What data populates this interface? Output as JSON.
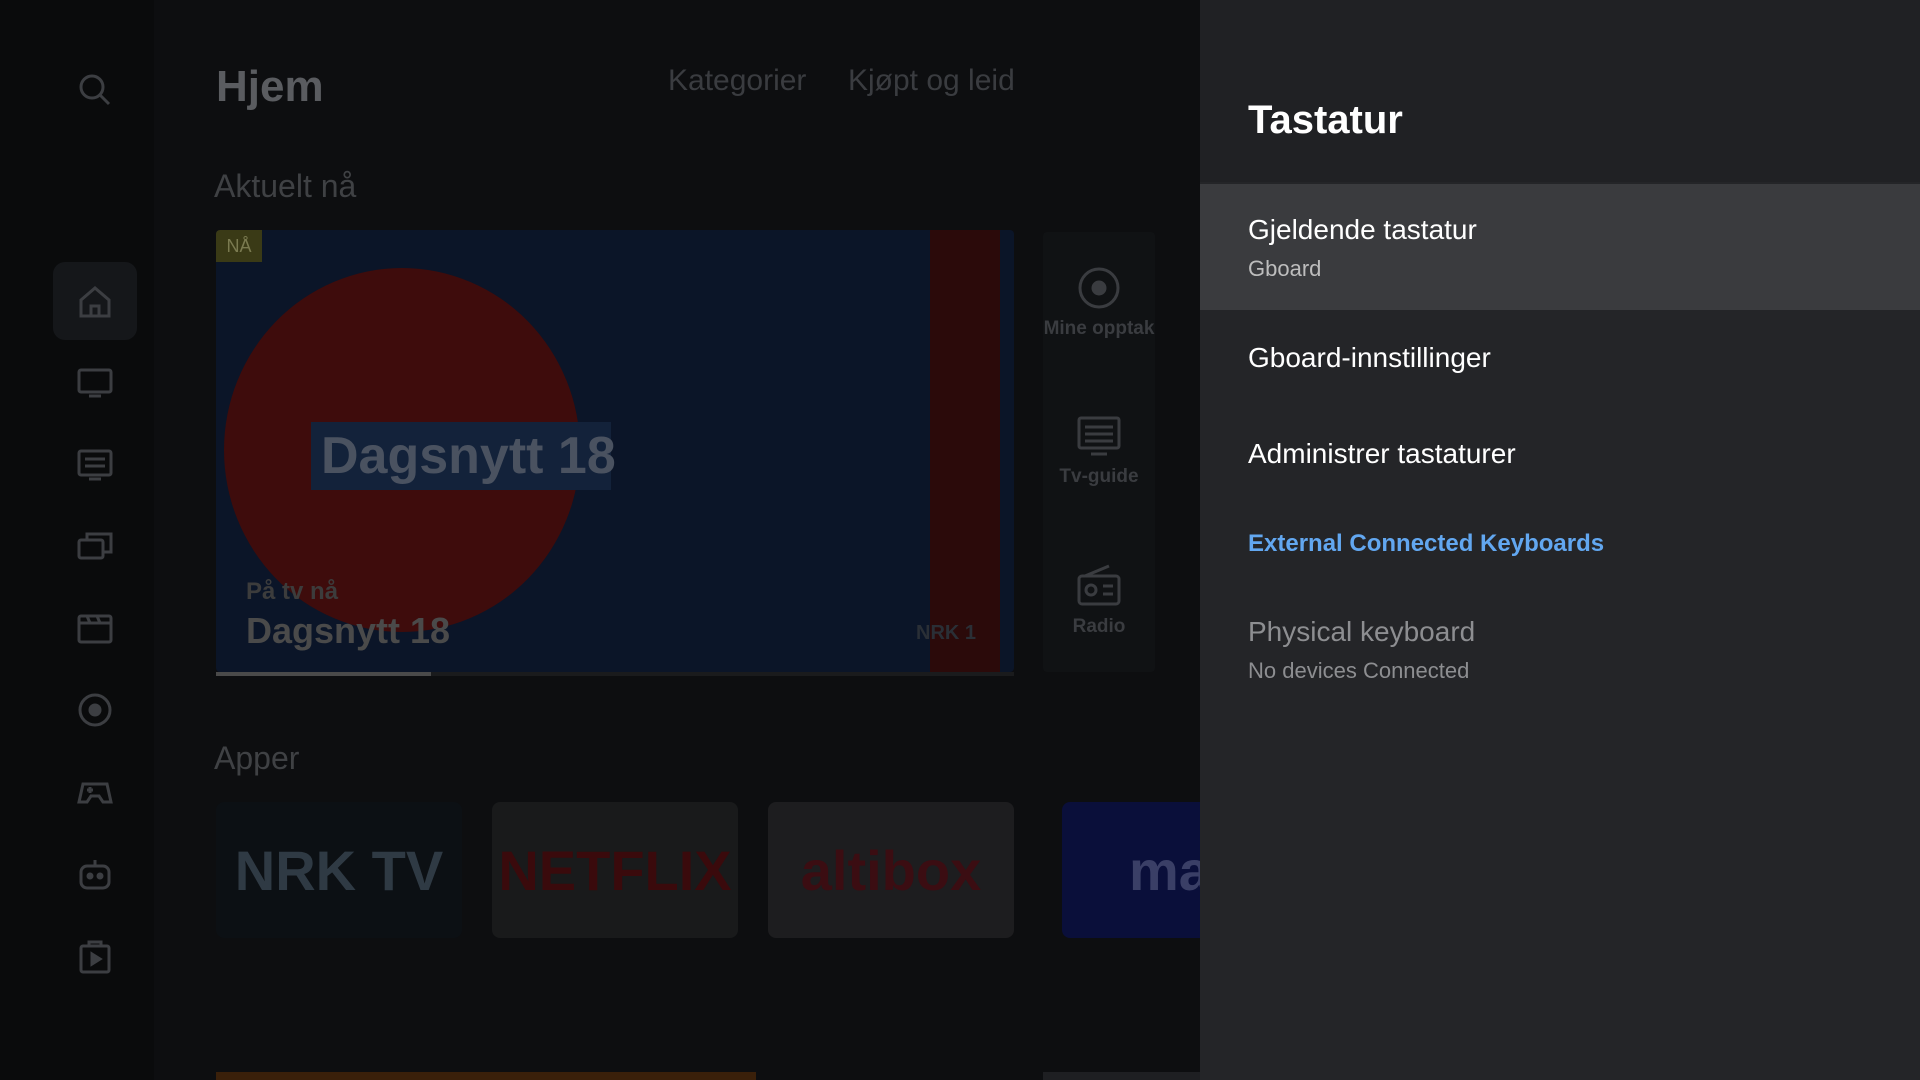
{
  "background": {
    "page_title": "Hjem",
    "nav_tabs": [
      "Kategorier",
      "Kjøpt og leid"
    ],
    "featured": {
      "section_title": "Aktuelt nå",
      "badge": "NÅ",
      "big_title": "Dagsnytt 18",
      "subtitle": "På tv nå",
      "title": "Dagsnytt 18",
      "channel_logo": "NRK 1",
      "progress": 0.27
    },
    "shortcuts": [
      {
        "icon": "record-icon",
        "label": "Mine opptak"
      },
      {
        "icon": "tv-guide-icon",
        "label": "Tv-guide"
      },
      {
        "icon": "radio-icon",
        "label": "Radio"
      }
    ],
    "apps_section_title": "Apper",
    "apps": [
      {
        "name": "NRK TV",
        "bg": "#0c1014",
        "color": "#2f3a44"
      },
      {
        "name": "NETFLIX",
        "bg": "#191a1b",
        "color": "#3a0a0c"
      },
      {
        "name": "altibox",
        "bg": "#1d1d1f",
        "color": "#3b0d12"
      },
      {
        "name": "max",
        "bg": "#0a0f3a",
        "color": "#3a3f66"
      }
    ],
    "rail_icons": [
      "search-icon",
      "home-icon",
      "tv-icon",
      "tv-guide-icon",
      "library-icon",
      "movies-icon",
      "recordings-icon",
      "games-icon",
      "kids-icon",
      "play-store-icon"
    ]
  },
  "panel": {
    "title": "Tastatur",
    "current_keyboard": {
      "label": "Gjeldende tastatur",
      "value": "Gboard"
    },
    "gboard_settings": "Gboard-innstillinger",
    "manage_keyboards": "Administrer tastaturer",
    "external_header": "External Connected Keyboards",
    "physical_keyboard": {
      "label": "Physical keyboard",
      "value": "No devices Connected"
    }
  },
  "colors": {
    "panel_bg": "#242528",
    "selected_item_bg": "#3a3b3e",
    "accent": "#62a7f0"
  }
}
